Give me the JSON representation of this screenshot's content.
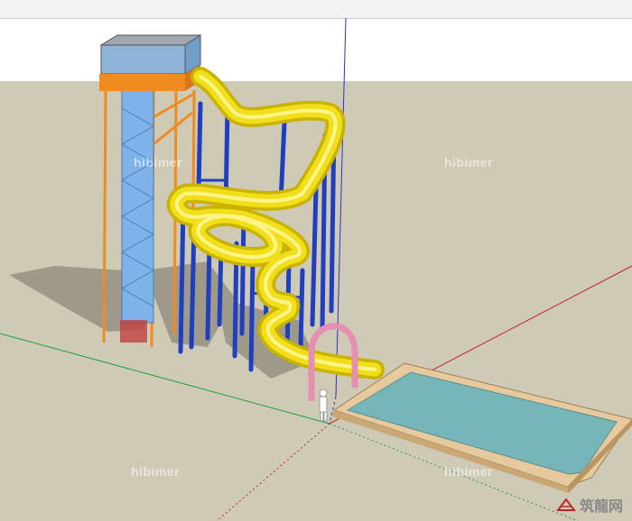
{
  "watermarks": [
    "hibimer",
    "hibimer",
    "hibimer",
    "hibimer"
  ],
  "logo": {
    "name": "site-logo",
    "text": "筑龍网"
  },
  "colors": {
    "sky": "#ffffff",
    "ground": "#cfcab6",
    "slide": "#f0df1a",
    "slide_dark": "#c9b200",
    "support": "#1f3fbf",
    "tower_roof": "#ef8b20",
    "tower_glass": "#8fb4d9",
    "stair": "#7fb2e8",
    "pool_edge": "#e6c99c",
    "pool_water": "#76b5b8",
    "arch": "#e58fb2",
    "axis_red": "#c0262a",
    "axis_green": "#20a040",
    "axis_blue": "#2b34c6"
  }
}
